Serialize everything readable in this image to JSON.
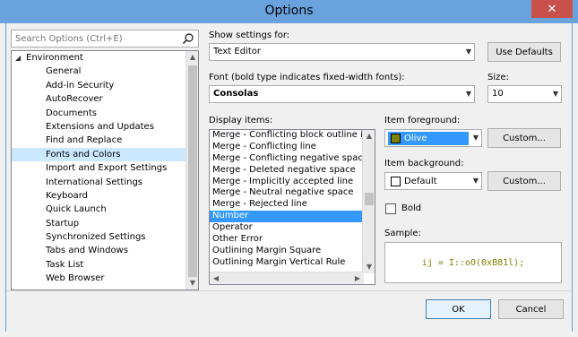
{
  "window": {
    "title": "Options",
    "close_glyph": "✕"
  },
  "search": {
    "placeholder": "Search Options (Ctrl+E)"
  },
  "tree": {
    "parent": "Environment",
    "items": [
      "General",
      "Add-in Security",
      "AutoRecover",
      "Documents",
      "Extensions and Updates",
      "Find and Replace",
      "Fonts and Colors",
      "Import and Export Settings",
      "International Settings",
      "Keyboard",
      "Quick Launch",
      "Startup",
      "Synchronized Settings",
      "Tabs and Windows",
      "Task List",
      "Web Browser"
    ],
    "selected_index": 6
  },
  "show_settings": {
    "label": "Show settings for:",
    "value": "Text Editor",
    "use_defaults": "Use Defaults"
  },
  "font": {
    "label": "Font (bold type indicates fixed-width fonts):",
    "value": "Consolas"
  },
  "size": {
    "label": "Size:",
    "value": "10"
  },
  "display_items": {
    "label": "Display items:",
    "items": [
      "Merge - Conflicting block outline ind",
      "Merge - Conflicting line",
      "Merge - Conflicting negative space",
      "Merge - Deleted negative space",
      "Merge - Implicitly accepted line",
      "Merge - Neutral negative space",
      "Merge - Rejected line",
      "Number",
      "Operator",
      "Other Error",
      "Outlining Margin Square",
      "Outlining Margin Vertical Rule"
    ],
    "selected_index": 7
  },
  "foreground": {
    "label": "Item foreground:",
    "value": "Olive",
    "color": "#808000",
    "custom": "Custom..."
  },
  "background": {
    "label": "Item background:",
    "value": "Default",
    "color": "#ffffff",
    "custom": "Custom..."
  },
  "bold": {
    "label": "Bold",
    "checked": false
  },
  "sample": {
    "label": "Sample:",
    "text": "ij = I::oO(0xB81l);",
    "color": "#808000"
  },
  "buttons": {
    "ok": "OK",
    "cancel": "Cancel"
  },
  "colors": {
    "titlebar": "#69a2dd",
    "selection": "#3399ff",
    "tree_selection": "#cce8ff"
  }
}
